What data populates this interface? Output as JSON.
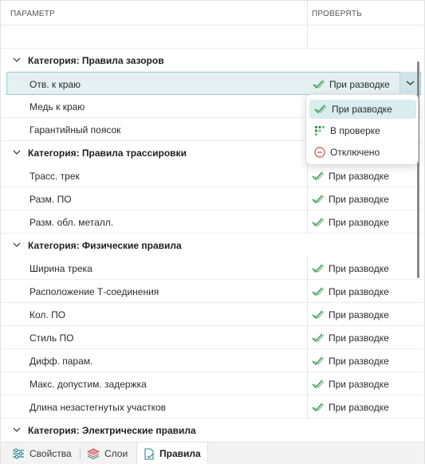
{
  "header": {
    "param": "ПАРАМЕТР",
    "check": "ПРОВЕРЯТЬ"
  },
  "categories": {
    "clearance": "Категория: Правила зазоров",
    "routing": "Категория: Правила трассировки",
    "physical": "Категория: Физические правила",
    "electrical": "Категория: Электрические правила"
  },
  "rows": {
    "r1": "Отв. к краю",
    "r2": "Медь к краю",
    "r3": "Гарантийный поясок",
    "r4": "Трасс. трек",
    "r5": "Разм. ПО",
    "r6": "Разм. обл. металл.",
    "r7": "Ширина трека",
    "r8": "Расположение Т-соединения",
    "r9": "Кол. ПО",
    "r10": "Стиль ПО",
    "r11": "Дифф. парам.",
    "r12": "Макс. допустим. задержка",
    "r13": "Длина незастегнутых участков"
  },
  "value_label": "При разводке",
  "popup": {
    "routing": "При разводке",
    "review": "В проверке",
    "off": "Отключено"
  },
  "tabs": {
    "properties": "Свойства",
    "layers": "Слои",
    "rules": "Правила"
  },
  "colors": {
    "check_green": "#3a9a52",
    "accent": "#9dc9cc",
    "off_red": "#c74a4a"
  }
}
